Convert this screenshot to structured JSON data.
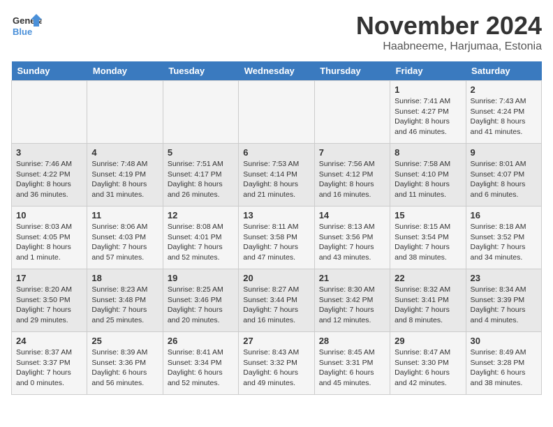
{
  "header": {
    "logo_general": "General",
    "logo_blue": "Blue",
    "month_year": "November 2024",
    "location": "Haabneeme, Harjumaa, Estonia"
  },
  "weekdays": [
    "Sunday",
    "Monday",
    "Tuesday",
    "Wednesday",
    "Thursday",
    "Friday",
    "Saturday"
  ],
  "weeks": [
    [
      {
        "day": "",
        "info": ""
      },
      {
        "day": "",
        "info": ""
      },
      {
        "day": "",
        "info": ""
      },
      {
        "day": "",
        "info": ""
      },
      {
        "day": "",
        "info": ""
      },
      {
        "day": "1",
        "info": "Sunrise: 7:41 AM\nSunset: 4:27 PM\nDaylight: 8 hours\nand 46 minutes."
      },
      {
        "day": "2",
        "info": "Sunrise: 7:43 AM\nSunset: 4:24 PM\nDaylight: 8 hours\nand 41 minutes."
      }
    ],
    [
      {
        "day": "3",
        "info": "Sunrise: 7:46 AM\nSunset: 4:22 PM\nDaylight: 8 hours\nand 36 minutes."
      },
      {
        "day": "4",
        "info": "Sunrise: 7:48 AM\nSunset: 4:19 PM\nDaylight: 8 hours\nand 31 minutes."
      },
      {
        "day": "5",
        "info": "Sunrise: 7:51 AM\nSunset: 4:17 PM\nDaylight: 8 hours\nand 26 minutes."
      },
      {
        "day": "6",
        "info": "Sunrise: 7:53 AM\nSunset: 4:14 PM\nDaylight: 8 hours\nand 21 minutes."
      },
      {
        "day": "7",
        "info": "Sunrise: 7:56 AM\nSunset: 4:12 PM\nDaylight: 8 hours\nand 16 minutes."
      },
      {
        "day": "8",
        "info": "Sunrise: 7:58 AM\nSunset: 4:10 PM\nDaylight: 8 hours\nand 11 minutes."
      },
      {
        "day": "9",
        "info": "Sunrise: 8:01 AM\nSunset: 4:07 PM\nDaylight: 8 hours\nand 6 minutes."
      }
    ],
    [
      {
        "day": "10",
        "info": "Sunrise: 8:03 AM\nSunset: 4:05 PM\nDaylight: 8 hours\nand 1 minute."
      },
      {
        "day": "11",
        "info": "Sunrise: 8:06 AM\nSunset: 4:03 PM\nDaylight: 7 hours\nand 57 minutes."
      },
      {
        "day": "12",
        "info": "Sunrise: 8:08 AM\nSunset: 4:01 PM\nDaylight: 7 hours\nand 52 minutes."
      },
      {
        "day": "13",
        "info": "Sunrise: 8:11 AM\nSunset: 3:58 PM\nDaylight: 7 hours\nand 47 minutes."
      },
      {
        "day": "14",
        "info": "Sunrise: 8:13 AM\nSunset: 3:56 PM\nDaylight: 7 hours\nand 43 minutes."
      },
      {
        "day": "15",
        "info": "Sunrise: 8:15 AM\nSunset: 3:54 PM\nDaylight: 7 hours\nand 38 minutes."
      },
      {
        "day": "16",
        "info": "Sunrise: 8:18 AM\nSunset: 3:52 PM\nDaylight: 7 hours\nand 34 minutes."
      }
    ],
    [
      {
        "day": "17",
        "info": "Sunrise: 8:20 AM\nSunset: 3:50 PM\nDaylight: 7 hours\nand 29 minutes."
      },
      {
        "day": "18",
        "info": "Sunrise: 8:23 AM\nSunset: 3:48 PM\nDaylight: 7 hours\nand 25 minutes."
      },
      {
        "day": "19",
        "info": "Sunrise: 8:25 AM\nSunset: 3:46 PM\nDaylight: 7 hours\nand 20 minutes."
      },
      {
        "day": "20",
        "info": "Sunrise: 8:27 AM\nSunset: 3:44 PM\nDaylight: 7 hours\nand 16 minutes."
      },
      {
        "day": "21",
        "info": "Sunrise: 8:30 AM\nSunset: 3:42 PM\nDaylight: 7 hours\nand 12 minutes."
      },
      {
        "day": "22",
        "info": "Sunrise: 8:32 AM\nSunset: 3:41 PM\nDaylight: 7 hours\nand 8 minutes."
      },
      {
        "day": "23",
        "info": "Sunrise: 8:34 AM\nSunset: 3:39 PM\nDaylight: 7 hours\nand 4 minutes."
      }
    ],
    [
      {
        "day": "24",
        "info": "Sunrise: 8:37 AM\nSunset: 3:37 PM\nDaylight: 7 hours\nand 0 minutes."
      },
      {
        "day": "25",
        "info": "Sunrise: 8:39 AM\nSunset: 3:36 PM\nDaylight: 6 hours\nand 56 minutes."
      },
      {
        "day": "26",
        "info": "Sunrise: 8:41 AM\nSunset: 3:34 PM\nDaylight: 6 hours\nand 52 minutes."
      },
      {
        "day": "27",
        "info": "Sunrise: 8:43 AM\nSunset: 3:32 PM\nDaylight: 6 hours\nand 49 minutes."
      },
      {
        "day": "28",
        "info": "Sunrise: 8:45 AM\nSunset: 3:31 PM\nDaylight: 6 hours\nand 45 minutes."
      },
      {
        "day": "29",
        "info": "Sunrise: 8:47 AM\nSunset: 3:30 PM\nDaylight: 6 hours\nand 42 minutes."
      },
      {
        "day": "30",
        "info": "Sunrise: 8:49 AM\nSunset: 3:28 PM\nDaylight: 6 hours\nand 38 minutes."
      }
    ]
  ]
}
